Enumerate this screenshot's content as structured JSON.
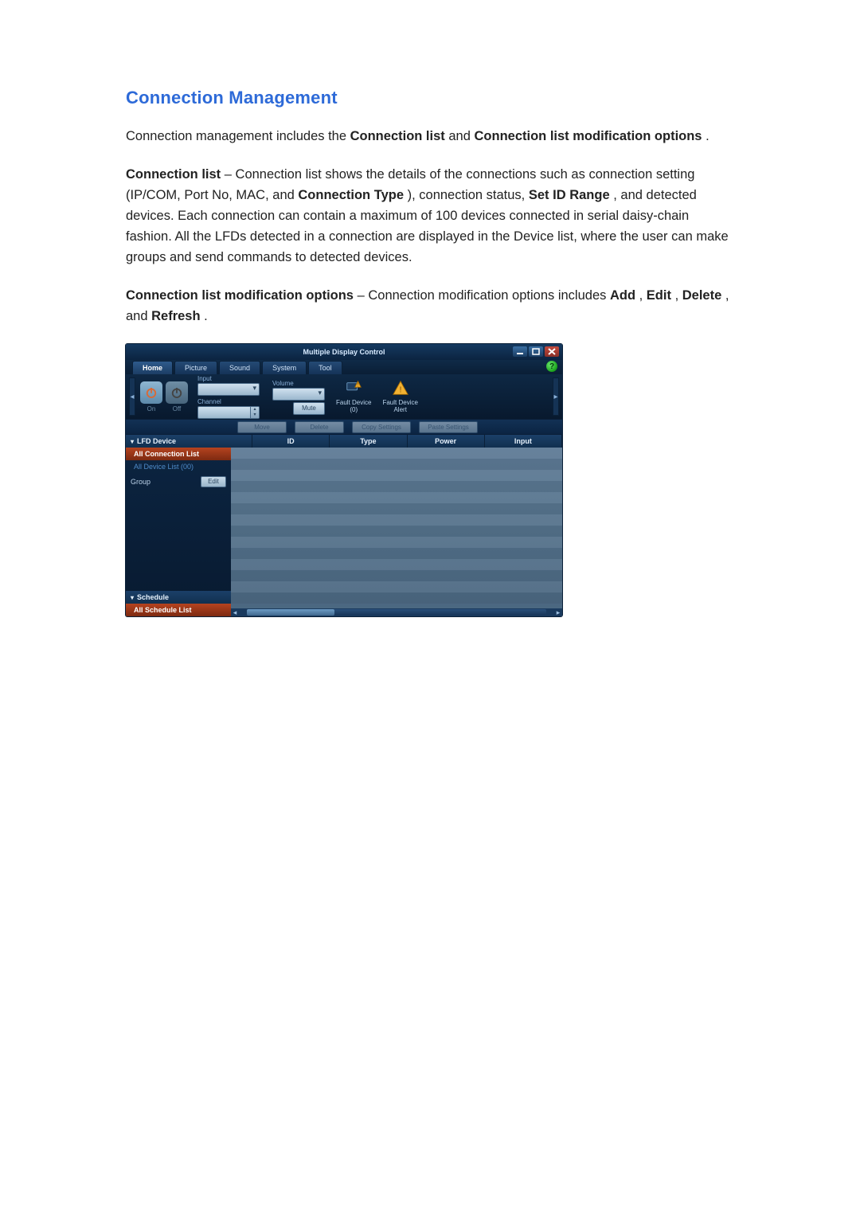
{
  "title": "Connection Management",
  "p1": {
    "t0": "Connection management includes the ",
    "b1": "Connection list",
    "t1": " and ",
    "b2": "Connection list modification options",
    "t2": "."
  },
  "p2": {
    "b0": "Connection list",
    "t0": " – Connection list shows the details of the connections such as connection setting (IP/COM, Port No, MAC, and ",
    "b1": "Connection Type",
    "t1": "), connection status, ",
    "b2": "Set ID Range",
    "t2": ", and detected devices. Each connection can contain a maximum of 100 devices connected in serial daisy-chain fashion. All the LFDs detected in a connection are displayed in the Device list, where the user can make groups and send commands to detected devices."
  },
  "p3": {
    "b0": "Connection list modification options",
    "t0": " – Connection modification options includes ",
    "b1": "Add",
    "t1": ", ",
    "b2": "Edit",
    "t2": ", ",
    "b3": "Delete",
    "t3": ", and ",
    "b4": "Refresh",
    "t4": "."
  },
  "mdc": {
    "window_title": "Multiple Display Control",
    "tabs": [
      "Home",
      "Picture",
      "Sound",
      "System",
      "Tool"
    ],
    "help": "?",
    "ribbon": {
      "power_on": "On",
      "power_off": "Off",
      "input_lbl": "Input",
      "channel_lbl": "Channel",
      "volume_lbl": "Volume",
      "mute_btn": "Mute",
      "fault0_a": "Fault Device",
      "fault0_b": "(0)",
      "fault1_a": "Fault Device",
      "fault1_b": "Alert"
    },
    "actions": {
      "move": "Move",
      "del": "Delete",
      "copy": "Copy Settings",
      "paste": "Paste Settings"
    },
    "side": {
      "lfd": "LFD Device",
      "all_conn": "All Connection List",
      "all_dev": "All Device List (00)",
      "group": "Group",
      "edit": "Edit",
      "sched": "Schedule",
      "all_sched": "All Schedule List"
    },
    "grid_cols": [
      "",
      "ID",
      "Type",
      "Power",
      "Input"
    ]
  }
}
